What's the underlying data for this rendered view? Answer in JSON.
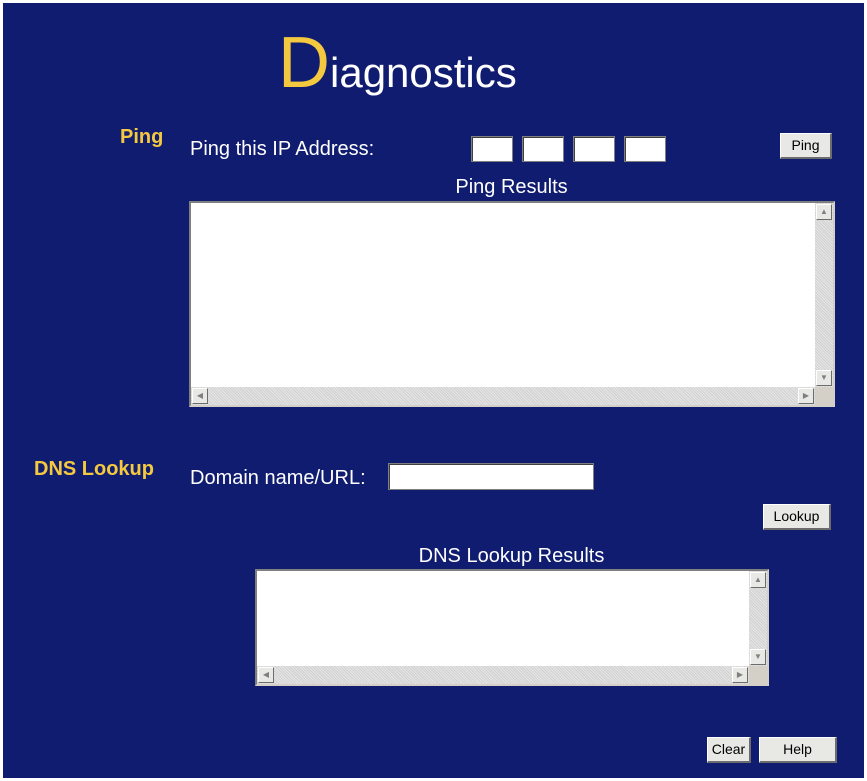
{
  "title": {
    "first_letter": "D",
    "rest": "iagnostics"
  },
  "ping": {
    "section_label": "Ping",
    "ip_label": "Ping this IP Address:",
    "ip_octets": [
      "",
      "",
      "",
      ""
    ],
    "button_label": "Ping",
    "results_label": "Ping Results",
    "results_value": ""
  },
  "dns": {
    "section_label": "DNS Lookup",
    "domain_label": "Domain name/URL:",
    "domain_value": "",
    "button_label": "Lookup",
    "results_label": "DNS Lookup Results",
    "results_value": ""
  },
  "footer": {
    "clear_label": "Clear",
    "help_label": "Help"
  },
  "colors": {
    "background": "#101c6f",
    "accent": "#f5c93f",
    "text": "#ffffff"
  }
}
